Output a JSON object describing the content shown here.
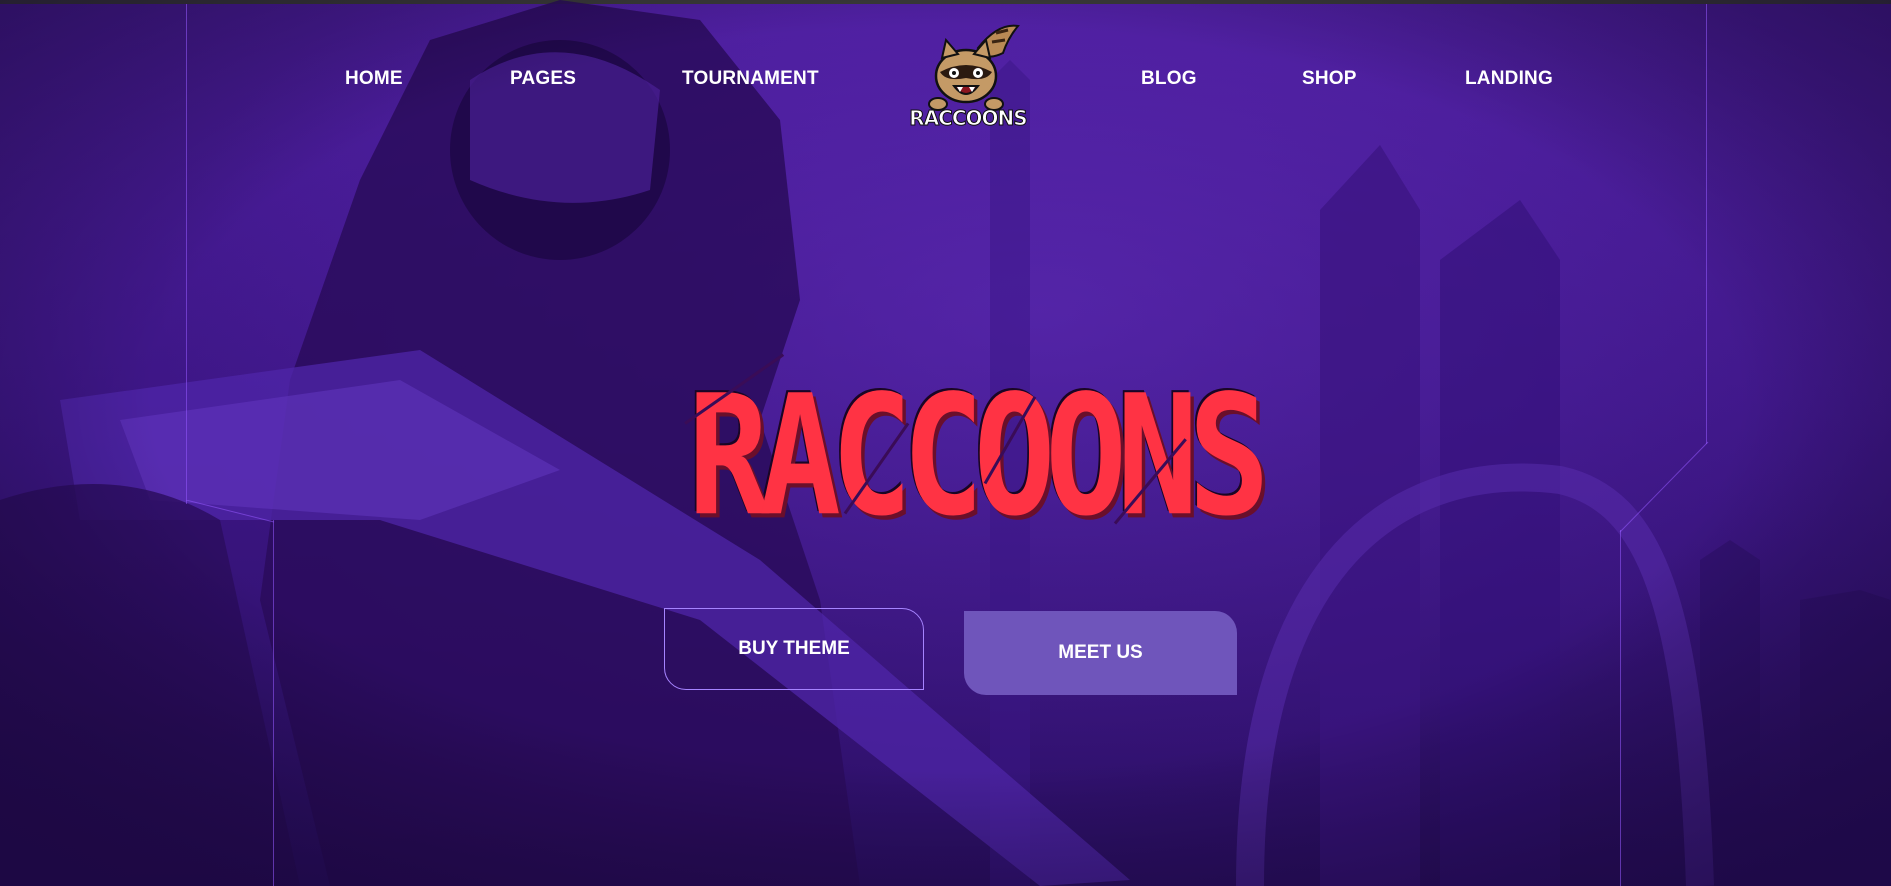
{
  "nav": {
    "left": [
      {
        "label": "HOME"
      },
      {
        "label": "PAGES"
      },
      {
        "label": "TOURNAMENT"
      }
    ],
    "right": [
      {
        "label": "BLOG"
      },
      {
        "label": "SHOP"
      },
      {
        "label": "LANDING"
      }
    ]
  },
  "logo": {
    "text": "RACCOONS",
    "icon": "raccoon-mascot-icon"
  },
  "hero": {
    "title": "RACCOONS"
  },
  "buttons": {
    "buy_theme": "BUY THEME",
    "meet_us": "MEET US"
  },
  "colors": {
    "background": "#3d1686",
    "title_red": "#ff3344",
    "button_fill": "#6f55bb",
    "button_border": "#a684ff",
    "frame_line": "#965aff"
  }
}
